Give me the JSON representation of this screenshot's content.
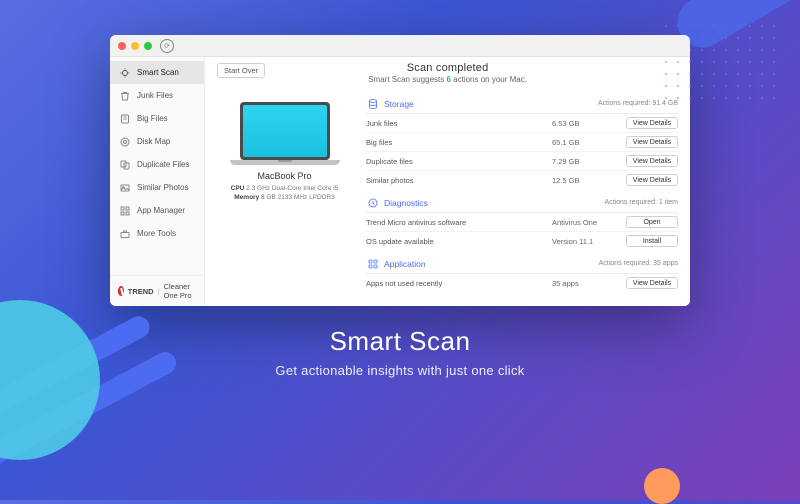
{
  "hero": {
    "title": "Smart Scan",
    "subtitle": "Get actionable insights with just one click"
  },
  "brand": {
    "name": "TREND",
    "product": "Cleaner One Pro"
  },
  "sidebar": {
    "items": [
      {
        "label": "Smart Scan"
      },
      {
        "label": "Junk Files"
      },
      {
        "label": "Big Files"
      },
      {
        "label": "Disk Map"
      },
      {
        "label": "Duplicate Files"
      },
      {
        "label": "Similar Photos"
      },
      {
        "label": "App Manager"
      },
      {
        "label": "More Tools"
      }
    ]
  },
  "toolbar": {
    "start_over": "Start Over"
  },
  "header": {
    "title": "Scan completed",
    "sub_pre": "Smart Scan suggests ",
    "count": "6",
    "sub_post": " actions on your Mac."
  },
  "device": {
    "name": "MacBook Pro",
    "cpu_label": "CPU",
    "cpu": "2.3 GHz Dual-Core Intel Core i5",
    "mem_label": "Memory",
    "mem": "8 GB 2133 MHz LPDDR3"
  },
  "storage": {
    "title": "Storage",
    "required": "Actions required: 91.4 GB",
    "rows": [
      {
        "label": "Junk files",
        "value": "6.53 GB",
        "action": "View Details"
      },
      {
        "label": "Big files",
        "value": "65.1 GB",
        "action": "View Details"
      },
      {
        "label": "Duplicate files",
        "value": "7.29 GB",
        "action": "View Details"
      },
      {
        "label": "Similar photos",
        "value": "12.5 GB",
        "action": "View Details"
      }
    ]
  },
  "diagnostics": {
    "title": "Diagnostics",
    "required": "Actions required: 1 item",
    "rows": [
      {
        "label": "Trend Micro antivirus software",
        "value": "Antivirus One",
        "action": "Open"
      },
      {
        "label": "OS update available",
        "value": "Version 11.1",
        "action": "Install"
      }
    ]
  },
  "application": {
    "title": "Application",
    "required": "Actions required: 35 apps",
    "rows": [
      {
        "label": "Apps not used recently",
        "value": "35 apps",
        "action": "View Details"
      }
    ]
  }
}
